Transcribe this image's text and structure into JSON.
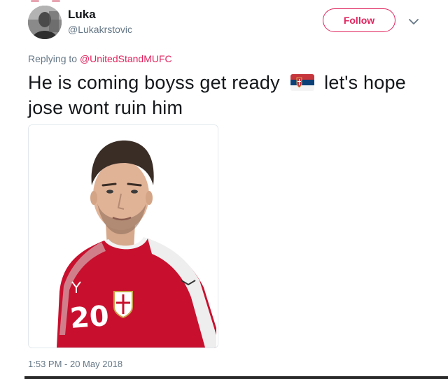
{
  "author": {
    "name": "Luka",
    "handle": "@Lukakrstovic"
  },
  "follow_label": "Follow",
  "reply": {
    "prefix": "Replying to",
    "mention": "@UnitedStandMUFC"
  },
  "tweet": {
    "text_before_flag": "He is coming boyss get ready",
    "flag_icon": "serbia-flag-icon",
    "text_after_flag": "let's hope jose wont ruin him"
  },
  "media": {
    "jersey_number": "20"
  },
  "timestamp": "1:53 PM - 20 May 2018",
  "colors": {
    "accent": "#e0245e",
    "secondary_text": "#657786",
    "primary_text": "#14171a",
    "jersey_red": "#c8102e"
  }
}
